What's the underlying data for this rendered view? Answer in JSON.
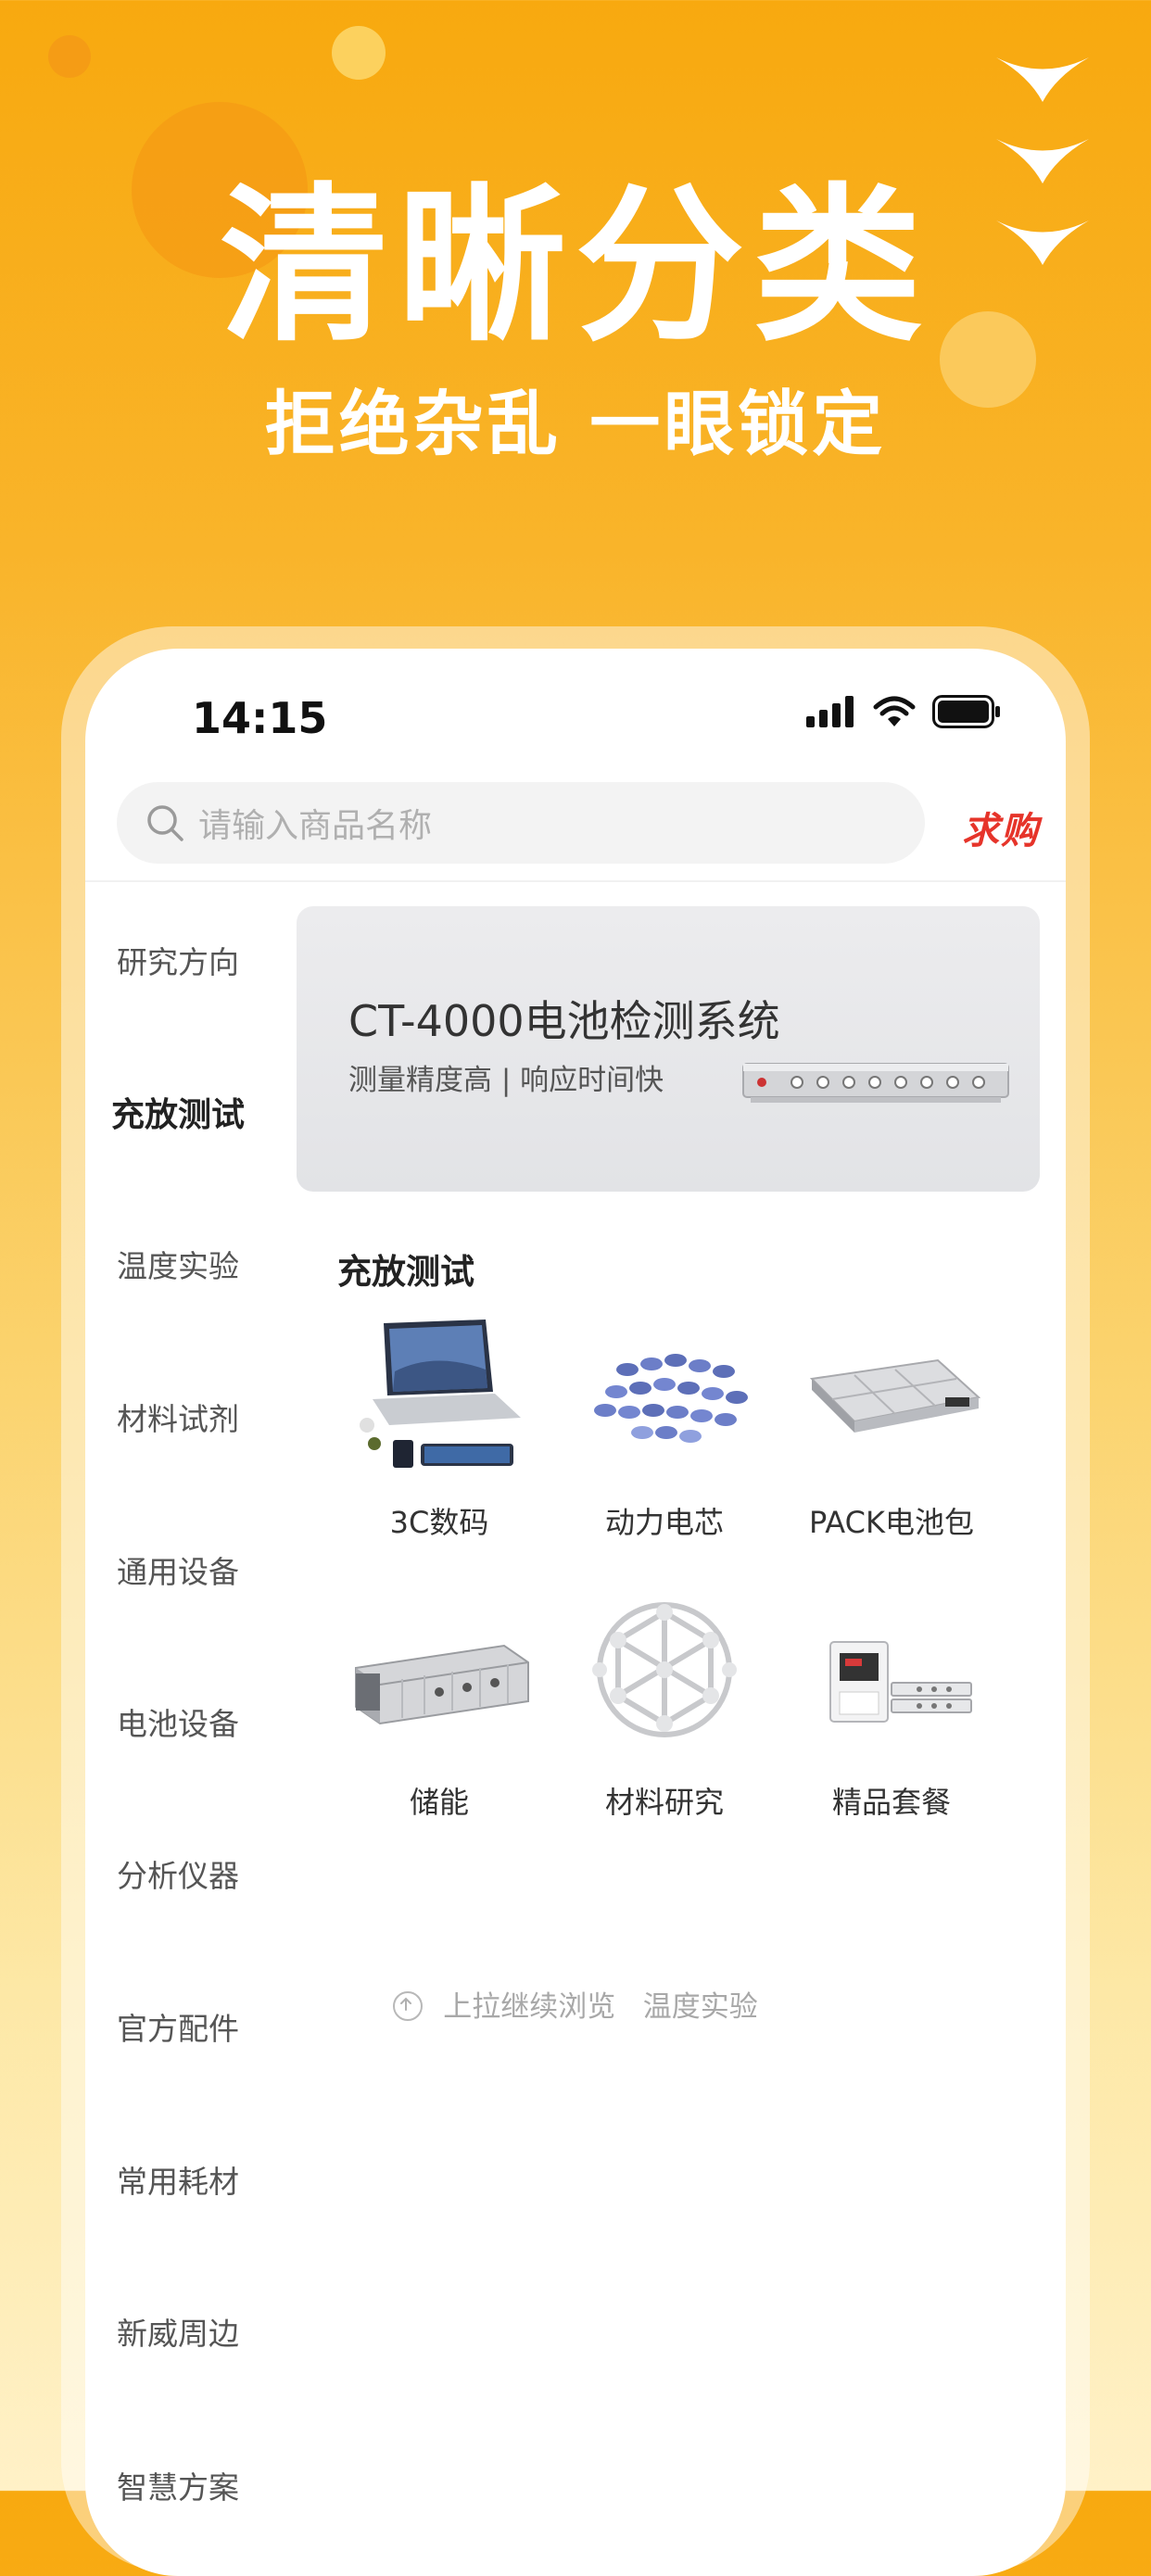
{
  "hero": {
    "title": "清晰分类",
    "subtitle": "拒绝杂乱 一眼锁定"
  },
  "status_bar": {
    "time": "14:15"
  },
  "search": {
    "placeholder": "请输入商品名称",
    "want_label": "求购"
  },
  "sidebar": {
    "items": [
      {
        "label": "研究方向",
        "active": false
      },
      {
        "label": "充放测试",
        "active": true
      },
      {
        "label": "温度实验",
        "active": false
      },
      {
        "label": "材料试剂",
        "active": false
      },
      {
        "label": "通用设备",
        "active": false
      },
      {
        "label": "电池设备",
        "active": false
      },
      {
        "label": "分析仪器",
        "active": false
      },
      {
        "label": "官方配件",
        "active": false
      },
      {
        "label": "常用耗材",
        "active": false
      },
      {
        "label": "新威周边",
        "active": false
      },
      {
        "label": "智慧方案",
        "active": false
      }
    ]
  },
  "banner": {
    "title": "CT-4000电池检测系统",
    "subtitle": "测量精度高 | 响应时间快"
  },
  "section": {
    "title": "充放测试",
    "items": [
      {
        "label": "3C数码",
        "icon": "laptop-tablet-phone-icon"
      },
      {
        "label": "动力电芯",
        "icon": "battery-cells-icon"
      },
      {
        "label": "PACK电池包",
        "icon": "battery-pack-icon"
      },
      {
        "label": "储能",
        "icon": "energy-storage-container-icon"
      },
      {
        "label": "材料研究",
        "icon": "molecule-structure-icon"
      },
      {
        "label": "精品套餐",
        "icon": "instrument-bundle-icon"
      }
    ]
  },
  "pull_hint": {
    "text": "上拉继续浏览",
    "next": "温度实验"
  },
  "colors": {
    "accent": "#f8a90f",
    "want": "#e6342a",
    "active_underline": "#f7b024"
  }
}
